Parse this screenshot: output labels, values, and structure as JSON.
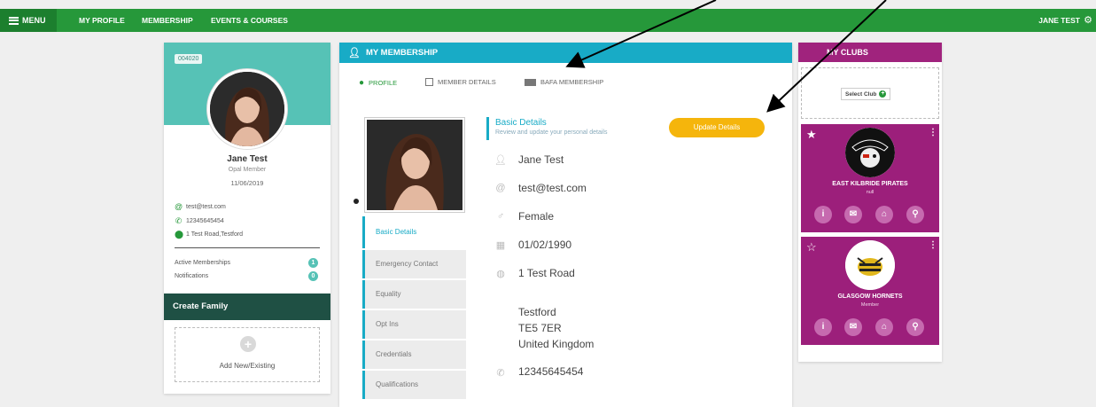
{
  "topbar": {
    "menu_label": "MENU",
    "nav": [
      "MY PROFILE",
      "MEMBERSHIP",
      "EVENTS & COURSES"
    ],
    "user_name": "JANE TEST"
  },
  "profile": {
    "member_id": "004020",
    "name": "Jane Test",
    "level": "Opal Member",
    "date": "11/06/2019",
    "email": "test@test.com",
    "phone": "12345645454",
    "address": "1 Test Road,Testford",
    "active_memberships_label": "Active Memberships",
    "active_memberships_count": "1",
    "notifications_label": "Notifications",
    "notifications_count": "0",
    "create_family_label": "Create Family",
    "add_new_label": "Add New/Existing"
  },
  "membership": {
    "header": "MY MEMBERSHIP",
    "tabs": [
      "PROFILE",
      "MEMBER DETAILS",
      "BAFA MEMBERSHIP"
    ],
    "side_tabs": [
      "Basic Details",
      "Emergency Contact",
      "Equality",
      "Opt Ins",
      "Credentials",
      "Qualifications"
    ],
    "basic_title": "Basic Details",
    "basic_subtitle": "Review and update your personal details",
    "update_button": "Update Details",
    "fields": {
      "name": "Jane Test",
      "email": "test@test.com",
      "gender": "Female",
      "dob": "01/02/1990",
      "address_line1": "1 Test Road",
      "town": "Testford",
      "postcode": "TE5 7ER",
      "country": "United Kingdom",
      "phone": "12345645454"
    }
  },
  "clubs": {
    "header": "MY CLUBS",
    "select_label": "Select Club",
    "list": [
      {
        "name": "EAST KILBRIDE PIRATES",
        "sub": "null",
        "favorite": true
      },
      {
        "name": "GLASGOW HORNETS",
        "sub": "Member",
        "favorite": false
      }
    ]
  },
  "colors": {
    "topbar": "#26983a",
    "teal": "#56c2b6",
    "cyan": "#18abc6",
    "magenta": "#9c1f7b",
    "amber": "#f5b50c"
  }
}
